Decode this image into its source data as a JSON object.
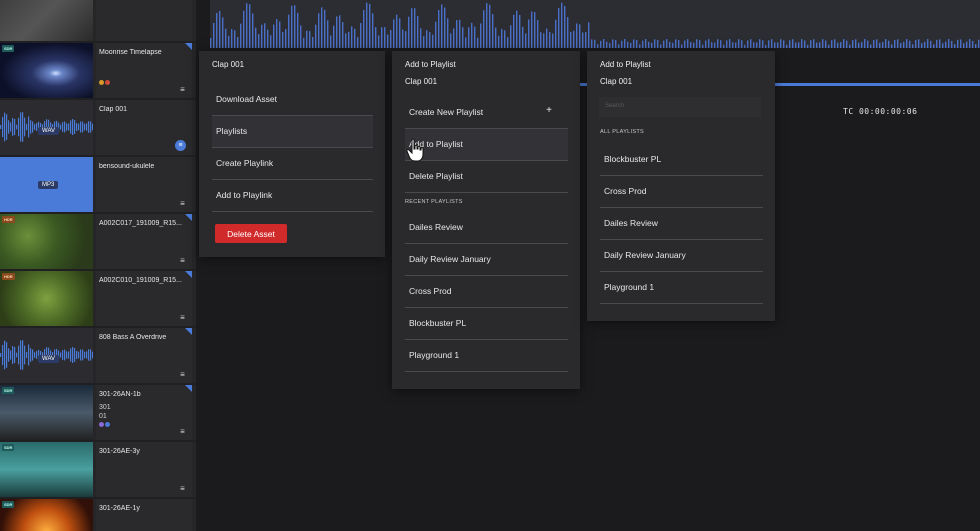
{
  "assets": [
    {
      "name": "",
      "badge": "",
      "fmt": "",
      "thumb": "dark",
      "corner": false
    },
    {
      "name": "Moonrise Timelapse",
      "badge": "SDR",
      "fmt": "",
      "thumb": "night",
      "corner": true,
      "dots": [
        "#d89a2a",
        "#d04a3a"
      ]
    },
    {
      "name": "Clap 001",
      "badge": "",
      "fmt": "WAV",
      "thumb": "wav",
      "corner": false,
      "sync": true
    },
    {
      "name": "bensound-ukulele",
      "badge": "",
      "fmt": "MP3",
      "thumb": "mp3",
      "corner": false
    },
    {
      "name": "A002C017_191009_R15...",
      "badge": "HDR",
      "fmt": "",
      "thumb": "foliage",
      "corner": true
    },
    {
      "name": "A002C010_191009_R15...",
      "badge": "HDR",
      "fmt": "",
      "thumb": "foliage2",
      "corner": true
    },
    {
      "name": "808 Bass A Overdrive",
      "badge": "",
      "fmt": "WAV",
      "thumb": "wav2",
      "corner": true
    },
    {
      "name": "301-26AN-1b",
      "sub1": "301",
      "sub2": "01",
      "badge": "SDR",
      "fmt": "",
      "thumb": "city",
      "corner": true,
      "dots": [
        "#8a6ad8",
        "#4a7bd8"
      ]
    },
    {
      "name": "301-26AE-3y",
      "badge": "SDR",
      "fmt": "",
      "thumb": "water",
      "corner": false
    },
    {
      "name": "301-26AE-1y",
      "badge": "SDR",
      "fmt": "",
      "thumb": "fire",
      "corner": false
    }
  ],
  "timecode": "TC 00:00:00:06",
  "menu1": {
    "title": "Clap 001",
    "items": [
      "Download Asset",
      "Playlists",
      "Create Playlink",
      "Add to Playlink"
    ],
    "delete_label": "Delete Asset"
  },
  "menu2": {
    "title": "Add to Playlist",
    "subtitle": "Clap 001",
    "create_label": "Create New Playlist",
    "plus": "+",
    "add_label": "Add to Playlist",
    "delete_label": "Delete Playlist",
    "section": "RECENT PLAYLISTS",
    "recent": [
      "Dailes Review",
      "Daily Review January",
      "Cross Prod",
      "Blockbuster PL",
      "Playground 1"
    ]
  },
  "menu3": {
    "title": "Add to Playlist",
    "subtitle": "Clap 001",
    "search_placeholder": "Search",
    "section": "ALL PLAYLISTS",
    "all": [
      "Blockbuster PL",
      "Cross Prod",
      "Dailes Review",
      "Daily Review January",
      "Playground 1"
    ]
  },
  "colors": {
    "accent": "#4a7bd8",
    "danger": "#d12a2a",
    "panel": "#2a2a2d"
  }
}
